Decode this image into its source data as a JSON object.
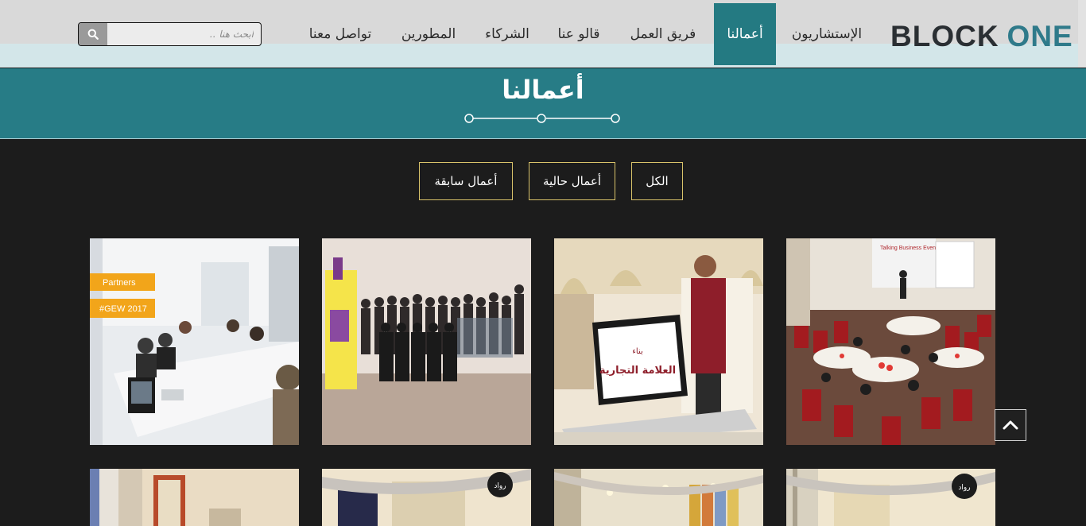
{
  "logo": {
    "word1": "BLOCK",
    "word2": "ONE"
  },
  "nav": {
    "items": [
      {
        "label": "الإستشاريون"
      },
      {
        "label": "أعمالنا",
        "active": true
      },
      {
        "label": "فريق العمل"
      },
      {
        "label": "قالو عنا"
      },
      {
        "label": "الشركاء"
      },
      {
        "label": "المطورين"
      },
      {
        "label": "تواصل معنا"
      }
    ]
  },
  "search": {
    "placeholder": "ابحث هنا ..",
    "icon": "search-icon"
  },
  "page": {
    "title": "أعمالنا"
  },
  "filters": [
    {
      "label": "الكل"
    },
    {
      "label": "أعمال حالية"
    },
    {
      "label": "أعمال سابقة"
    }
  ],
  "gallery": {
    "tile1": {
      "banner1": "Partners",
      "banner2": "#GEW 2017"
    },
    "tile2": {
      "screen_text1": "بناء",
      "screen_text2": "العلامة التجارية"
    },
    "tile4": {
      "poster_text": "Talking Business Events"
    },
    "row2_badge": "رواد"
  },
  "colors": {
    "accent": "#277c86",
    "filter_border": "#d9c36a",
    "background": "#1c1c1c"
  },
  "back_to_top": {
    "icon": "chevron-up-icon"
  }
}
